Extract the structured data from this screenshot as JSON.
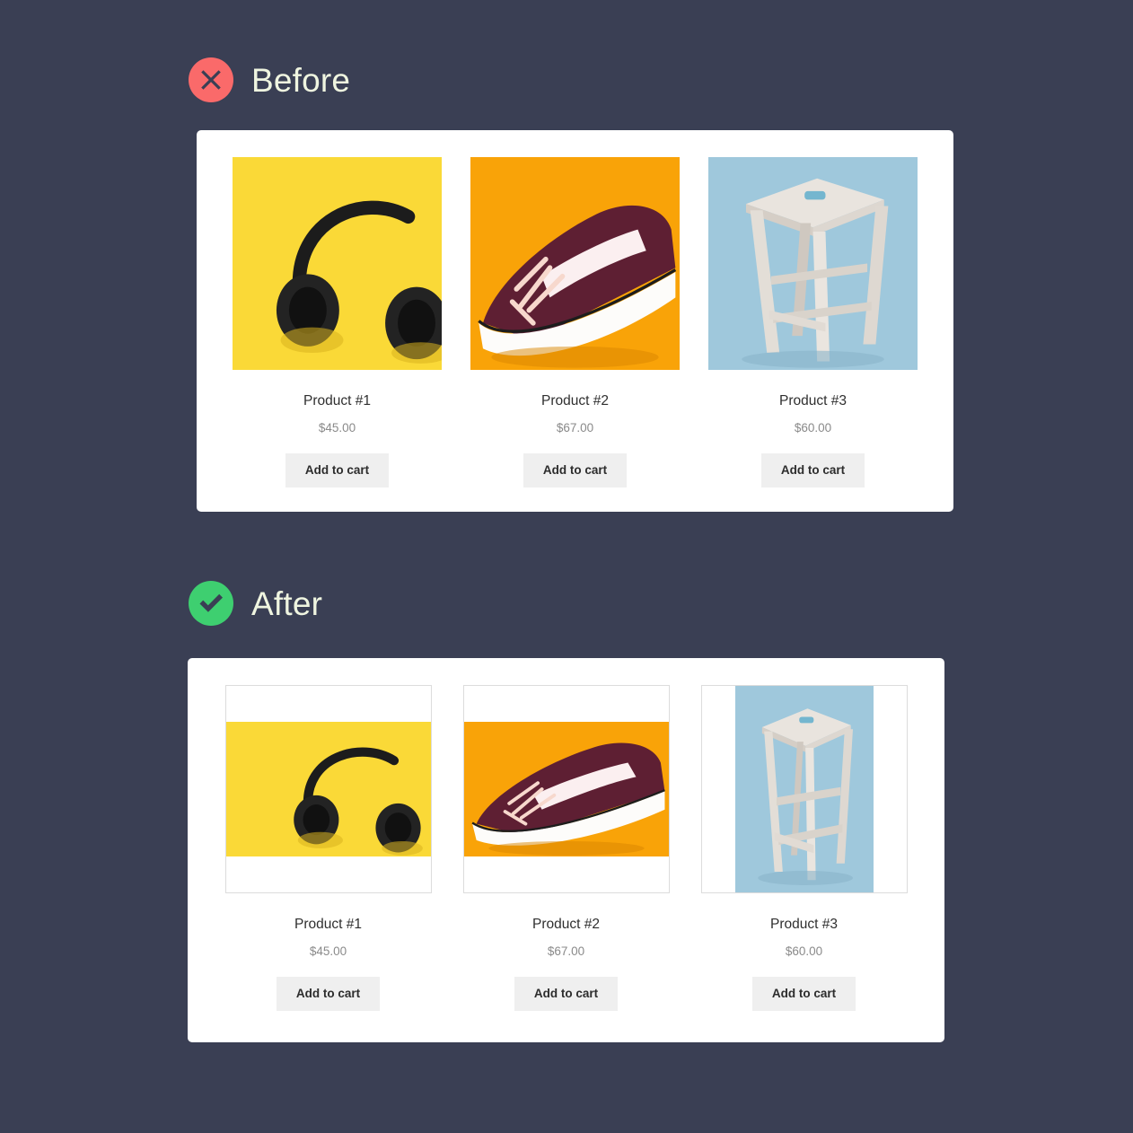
{
  "background_color": "#3a3f54",
  "sections": [
    {
      "id": "before",
      "heading": "Before",
      "icon": "circle-x-icon",
      "icon_color": "#fa6a6a",
      "image_mode": "fill"
    },
    {
      "id": "after",
      "heading": "After",
      "icon": "circle-check-icon",
      "icon_color": "#3ecf70",
      "image_mode": "fit"
    }
  ],
  "products": [
    {
      "title": "Product #1",
      "price": "$45.00",
      "button_label": "Add to cart",
      "image_alt": "black-headphones-on-yellow-background",
      "image_bg": "#fad937",
      "orientation": "landscape"
    },
    {
      "title": "Product #2",
      "price": "$67.00",
      "button_label": "Add to cart",
      "image_alt": "maroon-sneaker-on-orange-background",
      "image_bg": "#f9a308",
      "orientation": "landscape"
    },
    {
      "title": "Product #3",
      "price": "$60.00",
      "button_label": "Add to cart",
      "image_alt": "wooden-stool-on-light-blue-background",
      "image_bg": "#9fc8dc",
      "orientation": "portrait"
    }
  ],
  "colors": {
    "card": "#ffffff",
    "heading_text": "#eff5e0",
    "title_text": "#2f2f2f",
    "price_text": "#8a8a8a",
    "button_bg": "#efefef",
    "button_text": "#2c2c2c",
    "thumb_border": "#dcdcdc"
  }
}
